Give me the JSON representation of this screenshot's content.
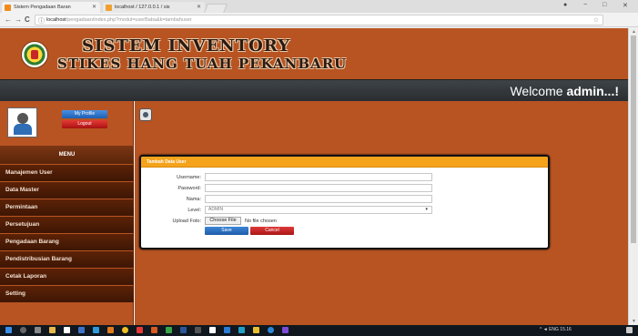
{
  "browser": {
    "tabs": [
      {
        "title": "Sistem Pengadaan Baran",
        "active": true,
        "favicon_color": "#f28a1a"
      },
      {
        "title": "localhost / 127.0.0.1 / sis",
        "active": false,
        "favicon_color": "#f0a030"
      }
    ],
    "address": {
      "host": "localhost",
      "path": "/pengadaan/index.php?modul=userBaba&k=tambahuser"
    },
    "controls": {
      "back": "←",
      "forward": "→",
      "reload": "C",
      "info": "ⓘ",
      "star": "☆",
      "menu": "⋮",
      "minimize": "−",
      "maximize": "□",
      "close": "✕",
      "profile": "●"
    }
  },
  "header": {
    "title": "SISTEM INVENTORY",
    "subtitle": "STIKES HANG TUAH PEKANBARU",
    "welcome_prefix": "Welcome ",
    "welcome_user": "admin...!"
  },
  "sidebar": {
    "profile_button": "My Profile",
    "logout_button": "Logout",
    "menu_title": "MENU",
    "items": [
      {
        "label": "Manajemen User"
      },
      {
        "label": "Data Master"
      },
      {
        "label": "Permintaan"
      },
      {
        "label": "Persetujuan"
      },
      {
        "label": "Pengadaan Barang"
      },
      {
        "label": "Pendistribusian Barang"
      },
      {
        "label": "Cetak Laporan"
      },
      {
        "label": "Setting"
      }
    ]
  },
  "form": {
    "panel_title": "Tambah Data User",
    "fields": {
      "username": {
        "label": "Username:",
        "value": ""
      },
      "password": {
        "label": "Password:",
        "value": ""
      },
      "nama": {
        "label": "Nama:",
        "value": ""
      },
      "level": {
        "label": "Level:",
        "value": "ADMIN"
      },
      "upload": {
        "label": "Upload Foto:",
        "button": "Choose File",
        "filename": "No file chosen"
      }
    },
    "save_button": "Save",
    "cancel_button": "Cancel"
  },
  "taskbar": {
    "tray_text": "^  ◄ ENG  15.16"
  },
  "colors": {
    "page_bg": "#b85422",
    "header_bar": "#2f3337",
    "menu_item": "#4a1a06",
    "panel_header": "#f5a31b",
    "save": "#2a6fc4",
    "cancel": "#c42222"
  }
}
